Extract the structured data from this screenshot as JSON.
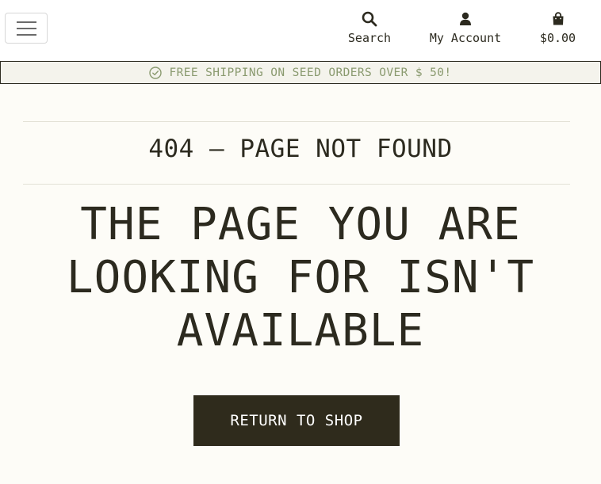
{
  "header": {
    "menu_icon": "hamburger-icon",
    "search": {
      "label": "Search",
      "icon": "search-icon"
    },
    "account": {
      "label": "My Account",
      "icon": "user-icon"
    },
    "cart": {
      "label": "$0.00",
      "icon": "shopping-bag-icon"
    }
  },
  "promo": {
    "icon": "check-circle-icon",
    "text": "FREE SHIPPING ON SEED ORDERS OVER $ 50!"
  },
  "error": {
    "status": "404 – PAGE NOT FOUND",
    "heading_lines": [
      "THE PAGE YOU ARE",
      "LOOKING FOR ISN'T",
      "AVAILABLE"
    ],
    "button_label": "RETURN TO SHOP"
  },
  "colors": {
    "background": "#fdfcf7",
    "text": "#2c2a1f",
    "button": "#2f2b1c",
    "promo_text": "#8a9a6f"
  }
}
